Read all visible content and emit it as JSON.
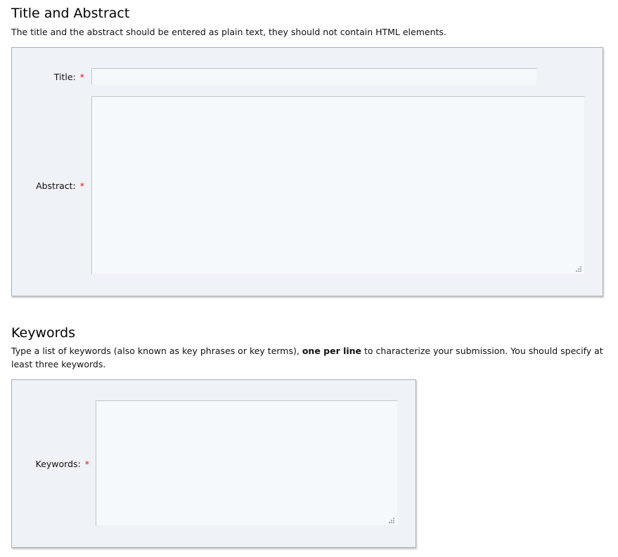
{
  "title_abstract_section": {
    "heading": "Title and Abstract",
    "description": "The title and the abstract should be entered as plain text, they should not contain HTML elements.",
    "title_label": "Title:",
    "title_value": "",
    "abstract_label": "Abstract:",
    "abstract_value": ""
  },
  "keywords_section": {
    "heading": "Keywords",
    "description_before": "Type a list of keywords (also known as key phrases or key terms), ",
    "description_bold": "one per line",
    "description_after": " to characterize your submission. You should specify at least three keywords.",
    "keywords_label": "Keywords:",
    "keywords_value": ""
  },
  "required_marker": "*",
  "colors": {
    "panel_background": "#eff2f6",
    "field_background": "#f6f9fc",
    "required_marker": "#d21a1a"
  }
}
